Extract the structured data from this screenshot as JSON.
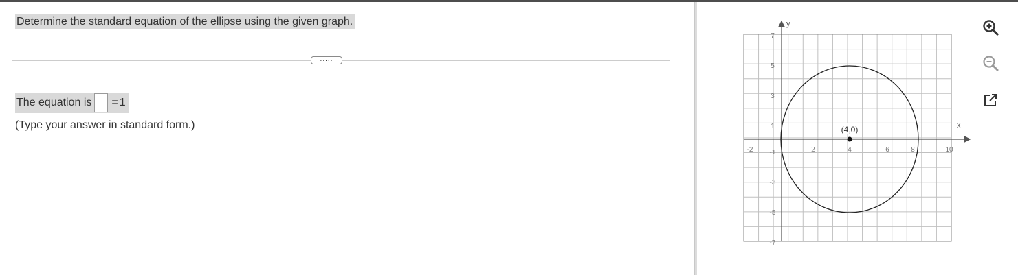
{
  "question": {
    "text": "Determine the standard equation of the ellipse using the given graph."
  },
  "more_button": {
    "label": "....."
  },
  "answer": {
    "prefix": "The equation is",
    "equals": "=",
    "rhs": "1",
    "input_value": "",
    "hint": "(Type your answer in standard form.)"
  },
  "graph": {
    "x_axis_label": "x",
    "y_axis_label": "y",
    "x_ticks": [
      "-2",
      "2",
      "4",
      "6",
      "8",
      "10"
    ],
    "y_ticks": [
      "7",
      "5",
      "3",
      "1",
      "-1",
      "-3",
      "-5",
      "-7"
    ],
    "center_label": "(4,0)"
  },
  "tools": {
    "zoom_in": "zoom-in-icon",
    "zoom_out": "zoom-out-icon",
    "popout": "external-link-icon"
  },
  "colors": {
    "highlight": "#d9d9d9",
    "grid": "#c0c0c0",
    "axis": "#555555",
    "curve": "#222222"
  }
}
